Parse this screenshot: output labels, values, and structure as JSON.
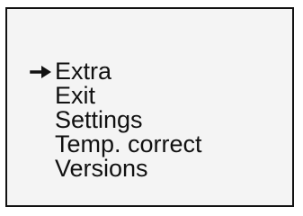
{
  "menu": {
    "selected_index": 0,
    "selection_icon": "arrow-right-icon",
    "items": [
      {
        "label": "Extra"
      },
      {
        "label": "Exit"
      },
      {
        "label": "Settings"
      },
      {
        "label": "Temp. correct"
      },
      {
        "label": "Versions"
      }
    ]
  },
  "colors": {
    "background": "#f4f4f4",
    "border": "#111111",
    "text": "#111111"
  }
}
